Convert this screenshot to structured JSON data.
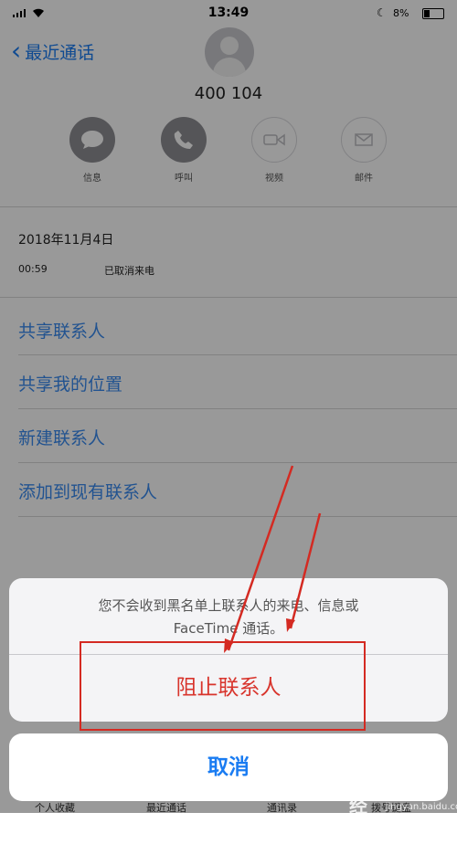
{
  "status_bar": {
    "time": "13:49",
    "battery": "8%"
  },
  "nav": {
    "back_label": "最近通话"
  },
  "contact": {
    "name": "400 104"
  },
  "actions": [
    {
      "label": "信息",
      "icon": "message-icon"
    },
    {
      "label": "呼叫",
      "icon": "phone-icon"
    },
    {
      "label": "视频",
      "icon": "video-icon"
    },
    {
      "label": "邮件",
      "icon": "mail-icon"
    }
  ],
  "call_log": {
    "date": "2018年11月4日",
    "time": "00:59",
    "status": "已取消来电"
  },
  "menu": [
    {
      "label": "共享联系人"
    },
    {
      "label": "共享我的位置"
    },
    {
      "label": "新建联系人"
    },
    {
      "label": "添加到现有联系人"
    }
  ],
  "action_sheet": {
    "message_line1": "您不会收到黑名单上联系人的来电、信息或",
    "message_line2": "FaceTime 通话。",
    "block_label": "阻止联系人",
    "cancel_label": "取消"
  },
  "tab_bar": [
    {
      "label": "个人收藏"
    },
    {
      "label": "最近通话"
    },
    {
      "label": "通讯录"
    },
    {
      "label": "拨号键盘"
    }
  ],
  "watermark": {
    "brand": "Bai经验",
    "sub": "jingyan.baidu.com"
  },
  "colors": {
    "accent": "#1a7cf2",
    "destructive": "#d8342c",
    "annotation": "#d42a22"
  }
}
